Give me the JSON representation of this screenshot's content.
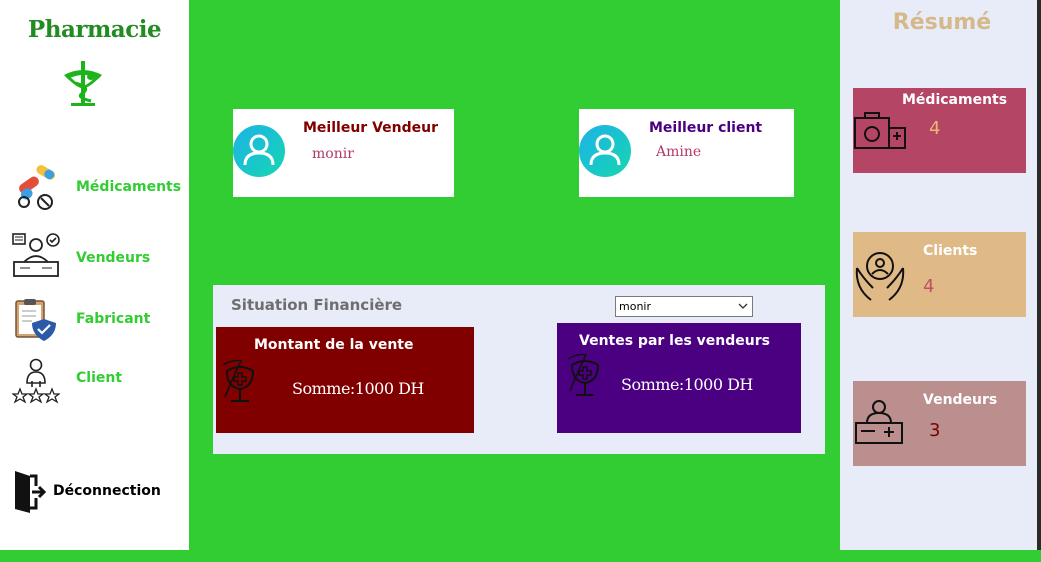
{
  "sidebar": {
    "brand": "Pharmacie",
    "items": [
      {
        "label": "Médicaments",
        "icon": "pills-icon"
      },
      {
        "label": "Vendeurs",
        "icon": "sellers-icon"
      },
      {
        "label": "Fabricant",
        "icon": "clipboard-shield-icon"
      },
      {
        "label": "Client",
        "icon": "client-rating-icon"
      }
    ],
    "logout": "Déconnection"
  },
  "best": {
    "vendor_title": "Meilleur Vendeur",
    "vendor_name": "monir",
    "client_title": "Meilleur client",
    "client_name": "Amine"
  },
  "finance": {
    "title": "Situation Financière",
    "select_value": "monir",
    "sale_title": "Montant de la vente",
    "sale_sum": "Somme:1000 DH",
    "vendors_title": "Ventes par les vendeurs",
    "vendors_sum": "Somme:1000 DH"
  },
  "summary": {
    "title": "Résumé",
    "cards": [
      {
        "label": "Médicaments",
        "value": "4",
        "color": "#b44565",
        "value_color": "#e8b87a"
      },
      {
        "label": "Clients",
        "value": "4",
        "color": "#dfba86",
        "value_color": "#c0506a"
      },
      {
        "label": "Vendeurs",
        "value": "3",
        "color": "#bc8f8f",
        "value_color": "#7a0000"
      }
    ]
  },
  "colors": {
    "background": "#32cd32",
    "sale_card": "#800000",
    "vendors_card": "#4b0082",
    "vendor_title": "#800000",
    "client_title": "#4b0082"
  }
}
